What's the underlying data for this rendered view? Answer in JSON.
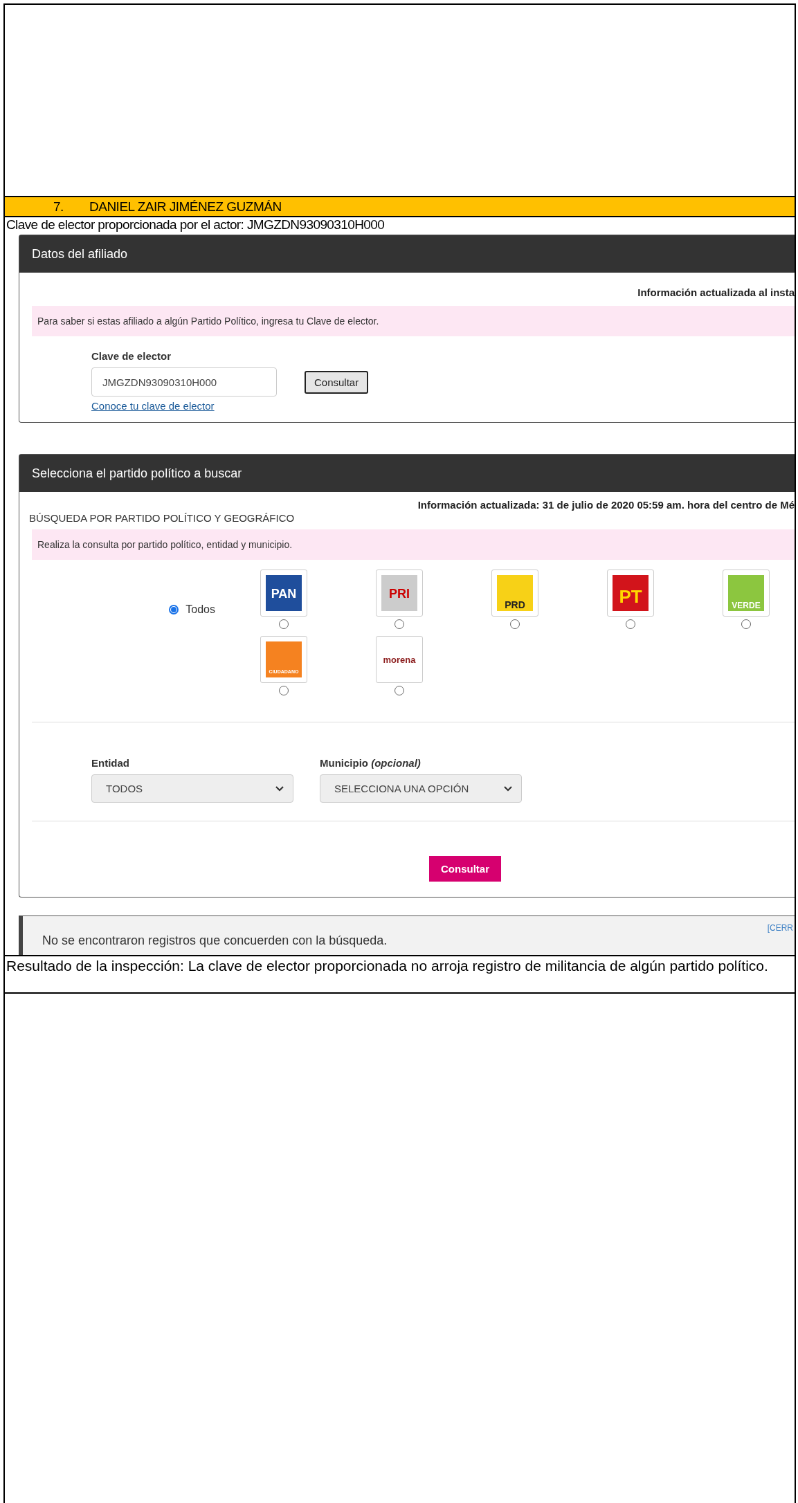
{
  "heading": {
    "number": "7.",
    "name": "DANIEL ZAIR JIMÉNEZ GUZMÁN"
  },
  "clave_line": "Clave de elector proporcionada por el actor: JMGZDN93090310H000",
  "affiliate_panel": {
    "title": "Datos del afiliado",
    "updated": "Información actualizada al insta",
    "notice": "Para saber si estas afiliado a algún Partido Político, ingresa tu Clave de elector.",
    "field_label": "Clave de elector",
    "field_value": "JMGZDN93090310H000",
    "button": "Consultar",
    "link": "Conoce tu clave de elector"
  },
  "party_panel": {
    "title": "Selecciona el partido político a buscar",
    "updated": "Información actualizada: 31 de julio de 2020 05:59 am. hora del centro de Mé",
    "subtitle": "BÚSQUEDA POR PARTIDO POLÍTICO Y GEOGRÁFICO",
    "notice": "Realiza la consulta por partido político, entidad y municipio.",
    "all_option": {
      "label": "Todos",
      "selected": true
    },
    "parties": [
      {
        "kind": "pan",
        "label": "PAN",
        "selected": false
      },
      {
        "kind": "pri",
        "label": "PRI",
        "selected": false
      },
      {
        "kind": "prd",
        "label": "PRD",
        "selected": false
      },
      {
        "kind": "pt",
        "label": "PT",
        "selected": false
      },
      {
        "kind": "verde",
        "label": "VERDE",
        "selected": false
      },
      {
        "kind": "mc",
        "label": "CIUDADANO",
        "selected": false
      },
      {
        "kind": "morena",
        "label": "morena",
        "selected": false
      }
    ],
    "entidad": {
      "label": "Entidad",
      "value": "TODOS"
    },
    "municipio": {
      "label": "Municipio *(opcional)*",
      "value": "SELECCIONA UNA OPCIÓN"
    },
    "button": "Consultar"
  },
  "result_box": {
    "message": "No se encontraron registros que concuerden con la búsqueda.",
    "close": "[CERR"
  },
  "result_line": "Resultado de la inspección: La clave de elector proporcionada no arroja registro de militancia de algún partido político."
}
